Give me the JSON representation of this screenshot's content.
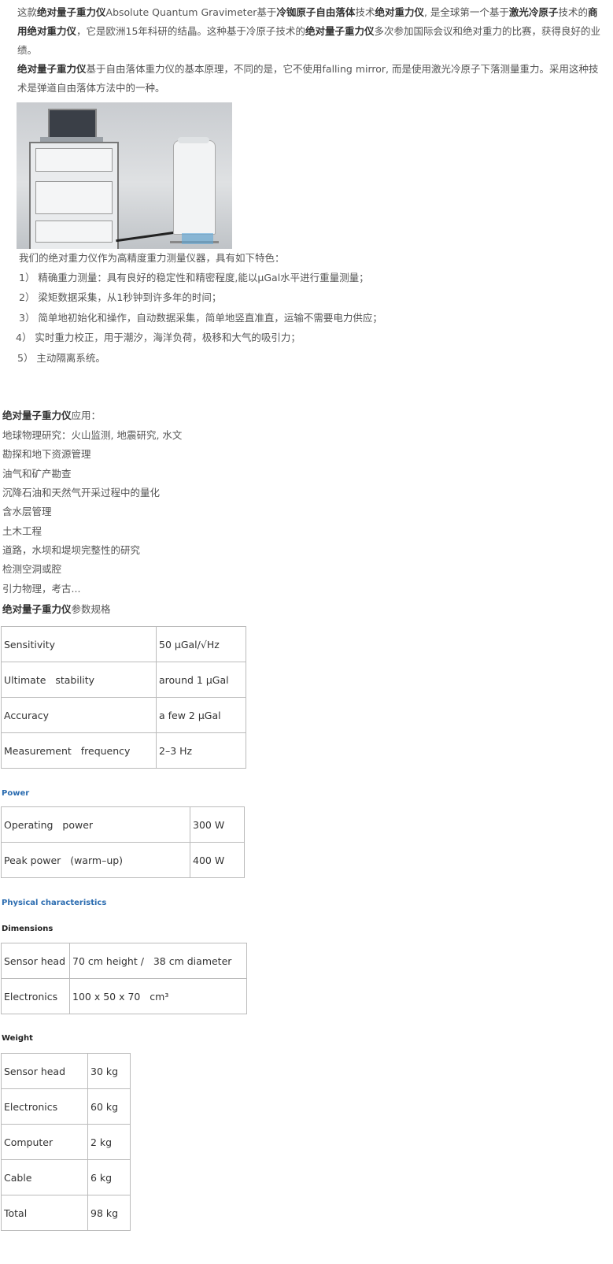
{
  "intro": {
    "p1": [
      {
        "t": "这款",
        "b": false
      },
      {
        "t": "绝对量子重力仪",
        "b": true
      },
      {
        "t": "Absolute Quantum Gravimeter基于",
        "b": false
      },
      {
        "t": "冷铷原子自由落体",
        "b": true
      },
      {
        "t": "技术",
        "b": false
      },
      {
        "t": "绝对重力仪",
        "b": true
      },
      {
        "t": ", 是全球第一个基于",
        "b": false
      },
      {
        "t": "激光冷原子",
        "b": true
      },
      {
        "t": "技术的",
        "b": false
      },
      {
        "t": "商用绝对重力仪",
        "b": true
      },
      {
        "t": "，它是欧洲15年科研的结晶。这种基于冷原子技术的",
        "b": false
      },
      {
        "t": "绝对量子重力仪",
        "b": true
      },
      {
        "t": "多次参加国际会议和绝对重力的比赛，获得良好的业绩。",
        "b": false
      }
    ],
    "p2": [
      {
        "t": "绝对量子重力仪",
        "b": true
      },
      {
        "t": "基于自由落体重力仪的基本原理，不同的是，它不使用falling mirror, 而是使用激光冷原子下落测量重力。采用这种技术是弹道自由落体方法中的一种。",
        "b": false
      }
    ]
  },
  "features": {
    "intro": "我们的绝对重力仪作为高精度重力测量仪器，具有如下特色：",
    "items": [
      "1）  精确重力测量：具有良好的稳定性和精密程度,能以μGal水平进行重量测量；",
      "2）  梁矩数据采集，从1秒钟到许多年的时间；",
      "3）  简单地初始化和操作，自动数据采集，简单地竖直准直，运输不需要电力供应；",
      "4）  实时重力校正，用于潮汐，海洋负荷，极移和大气的吸引力；",
      "5）  主动隔离系统。"
    ]
  },
  "applications": {
    "title_bold": "绝对量子重力仪",
    "title_rest": "应用：",
    "items": [
      "地球物理研究：火山监测, 地震研究, 水文",
      "勘探和地下资源管理",
      "油气和矿产勘查",
      "沉降石油和天然气开采过程中的量化",
      "含水层管理",
      "土木工程",
      "道路，水坝和堤坝完整性的研究",
      "检测空洞或腔",
      "引力物理，考古..."
    ],
    "spec_title_bold": "绝对量子重力仪",
    "spec_title_rest": "参数规格"
  },
  "spec_table": [
    [
      "Sensitivity",
      "50 μGal/√Hz"
    ],
    [
      "Ultimate   stability",
      "around 1 μGal"
    ],
    [
      "Accuracy",
      "a few 2 μGal"
    ],
    [
      "Measurement   frequency",
      "2–3 Hz"
    ]
  ],
  "power": {
    "title": "Power",
    "rows": [
      [
        "Operating   power",
        "300 W"
      ],
      [
        "Peak power   (warm–up)",
        "400 W"
      ]
    ]
  },
  "physical": {
    "title": "Physical characteristics",
    "dimensions_title": "Dimensions",
    "dimensions": [
      [
        "Sensor head",
        "70 cm height /   38 cm diameter"
      ],
      [
        "Electronics",
        "100 x 50 x 70   cm³"
      ]
    ],
    "weight_title": "Weight",
    "weight": [
      [
        "Sensor head",
        "30 kg"
      ],
      [
        "Electronics",
        "60 kg"
      ],
      [
        "Computer",
        "2 kg"
      ],
      [
        "Cable",
        "6 kg"
      ],
      [
        "Total",
        "98 kg"
      ]
    ]
  }
}
